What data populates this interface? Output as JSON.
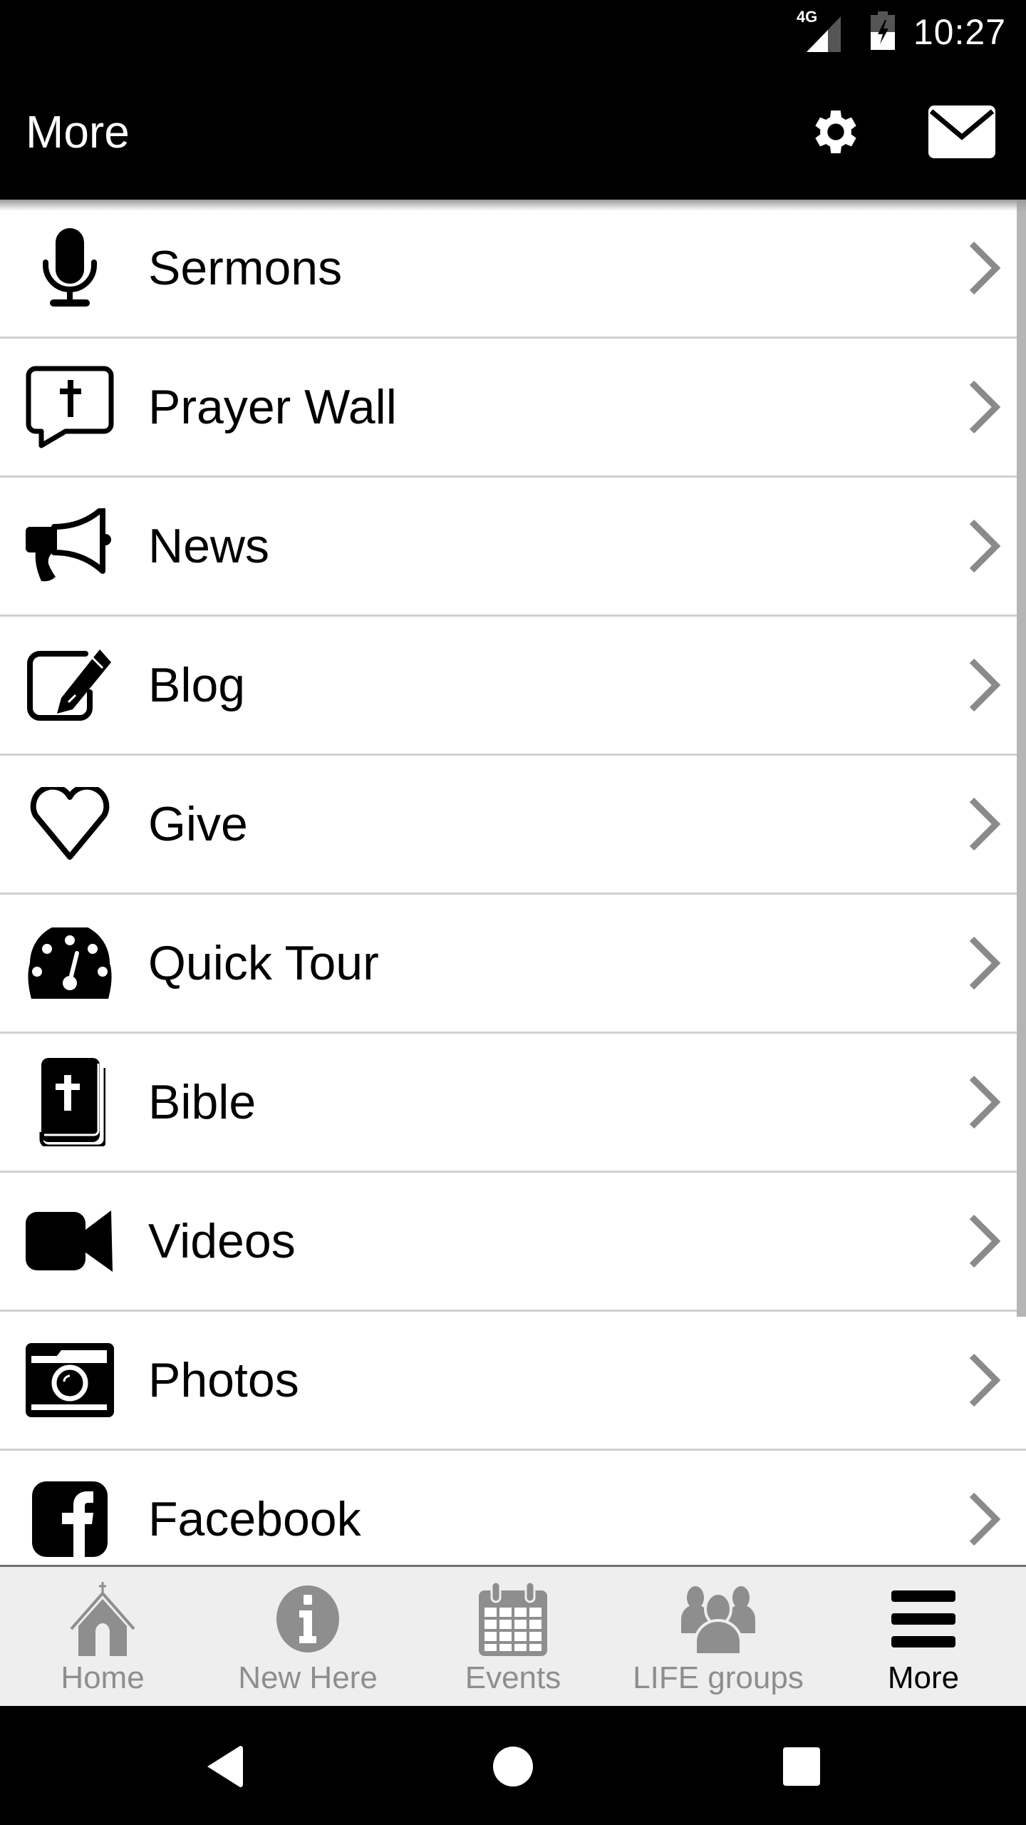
{
  "status_bar": {
    "network": "4G",
    "time": "10:27",
    "icons": [
      "signal-icon",
      "battery-charging-icon"
    ]
  },
  "app_bar": {
    "title": "More",
    "actions": [
      {
        "name": "settings",
        "icon": "gear-icon"
      },
      {
        "name": "messages",
        "icon": "envelope-icon"
      }
    ]
  },
  "menu": {
    "items": [
      {
        "label": "Sermons",
        "icon": "microphone-icon"
      },
      {
        "label": "Prayer Wall",
        "icon": "speech-bubble-cross-icon"
      },
      {
        "label": "News",
        "icon": "megaphone-icon"
      },
      {
        "label": "Blog",
        "icon": "edit-pencil-icon"
      },
      {
        "label": "Give",
        "icon": "heart-icon"
      },
      {
        "label": "Quick Tour",
        "icon": "dashboard-gauge-icon"
      },
      {
        "label": "Bible",
        "icon": "bible-icon"
      },
      {
        "label": "Videos",
        "icon": "video-camera-icon"
      },
      {
        "label": "Photos",
        "icon": "camera-icon"
      },
      {
        "label": "Facebook",
        "icon": "facebook-icon"
      }
    ],
    "chevron_icon": "chevron-right-icon"
  },
  "bottom_nav": {
    "tabs": [
      {
        "label": "Home",
        "icon": "church-icon",
        "active": false
      },
      {
        "label": "New Here",
        "icon": "info-icon",
        "active": false
      },
      {
        "label": "Events",
        "icon": "calendar-icon",
        "active": false
      },
      {
        "label": "LIFE groups",
        "icon": "group-icon",
        "active": false
      },
      {
        "label": "More",
        "icon": "hamburger-menu-icon",
        "active": true
      }
    ]
  },
  "system_nav": {
    "buttons": [
      "back",
      "home",
      "recents"
    ]
  },
  "colors": {
    "bar_background": "#000000",
    "inactive_tab": "#8e8e8e",
    "active_tab": "#000000",
    "chevron": "#8a8a8a",
    "divider": "#d0d0d0",
    "tabbar_background": "#eeeeee"
  }
}
